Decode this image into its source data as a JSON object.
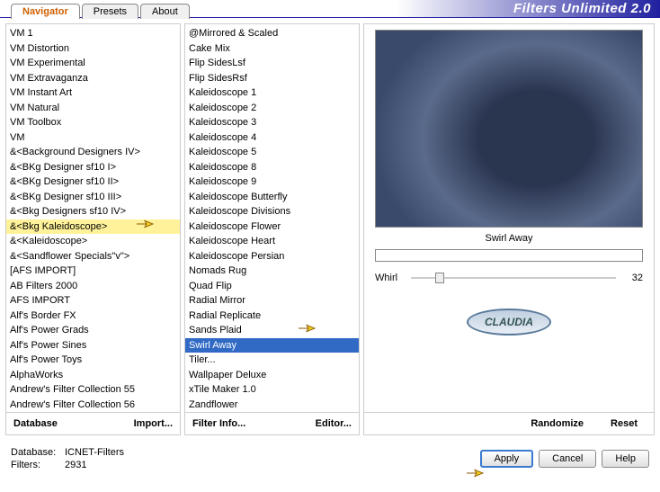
{
  "app_title": "Filters Unlimited 2.0",
  "tabs": [
    "Navigator",
    "Presets",
    "About"
  ],
  "active_tab": 0,
  "left_list": [
    "VM 1",
    "VM Distortion",
    "VM Experimental",
    "VM Extravaganza",
    "VM Instant Art",
    "VM Natural",
    "VM Toolbox",
    "VM",
    "&<Background Designers IV>",
    "&<BKg Designer sf10 I>",
    "&<BKg Designer sf10 II>",
    "&<BKg Designer sf10 III>",
    "&<Bkg Designers sf10 IV>",
    "&<Bkg Kaleidoscope>",
    "&<Kaleidoscope>",
    "&<Sandflower Specials\"v\">",
    "[AFS IMPORT]",
    "AB Filters 2000",
    "AFS IMPORT",
    "Alf's Border FX",
    "Alf's Power Grads",
    "Alf's Power Sines",
    "Alf's Power Toys",
    "AlphaWorks",
    "Andrew's Filter Collection 55",
    "Andrew's Filter Collection 56"
  ],
  "left_selected": 13,
  "mid_list": [
    "@Mirrored & Scaled",
    "Cake Mix",
    "Flip SidesLsf",
    "Flip SidesRsf",
    "Kaleidoscope 1",
    "Kaleidoscope 2",
    "Kaleidoscope 3",
    "Kaleidoscope 4",
    "Kaleidoscope 5",
    "Kaleidoscope 8",
    "Kaleidoscope 9",
    "Kaleidoscope Butterfly",
    "Kaleidoscope Divisions",
    "Kaleidoscope Flower",
    "Kaleidoscope Heart",
    "Kaleidoscope Persian",
    "Nomads Rug",
    "Quad Flip",
    "Radial Mirror",
    "Radial Replicate",
    "Sands Plaid",
    "Swirl Away",
    "Tiler...",
    "Wallpaper Deluxe",
    "xTile Maker 1.0",
    "Zandflower"
  ],
  "mid_selected": 21,
  "left_footer": {
    "db": "Database",
    "imp": "Import..."
  },
  "mid_footer": {
    "info": "Filter Info...",
    "ed": "Editor..."
  },
  "preview_title": "Swirl Away",
  "slider": {
    "label": "Whirl",
    "value": "32"
  },
  "logo_text": "CLAUDIA",
  "right_footer": {
    "rand": "Randomize",
    "reset": "Reset"
  },
  "status": {
    "db_label": "Database:",
    "db_val": "ICNET-Filters",
    "fl_label": "Filters:",
    "fl_val": "2931"
  },
  "buttons": {
    "apply": "Apply",
    "cancel": "Cancel",
    "help": "Help"
  }
}
